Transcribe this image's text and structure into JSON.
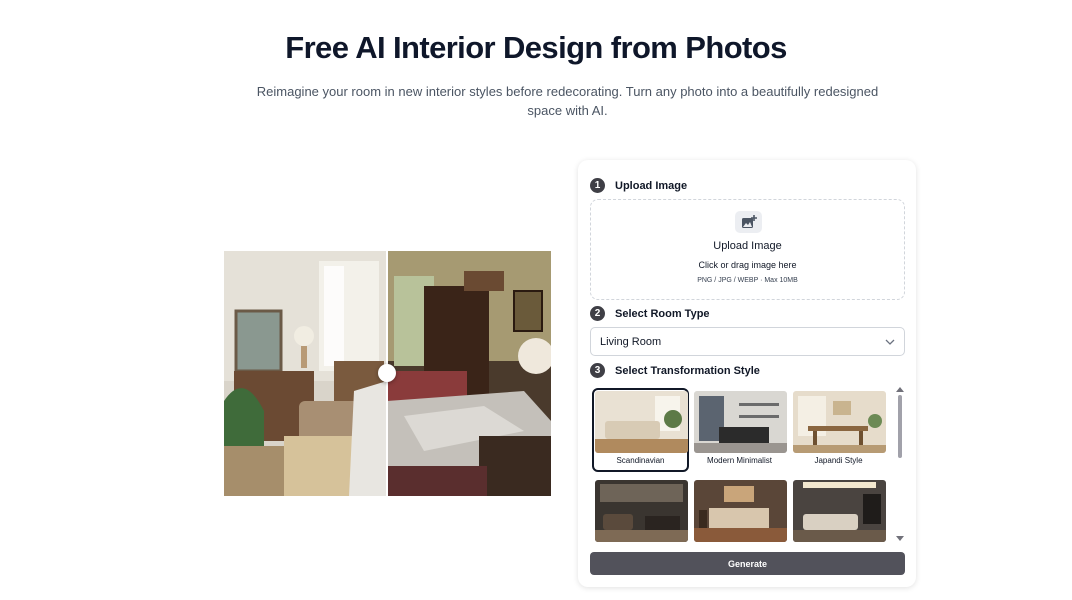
{
  "hero": {
    "title": "Free AI Interior Design from Photos",
    "subtitle": "Reimagine your room in new interior styles before redecorating. Turn any photo into a beautifully redesigned space with AI."
  },
  "steps": [
    {
      "number": "1",
      "label": "Upload Image"
    },
    {
      "number": "2",
      "label": "Select Room Type"
    },
    {
      "number": "3",
      "label": "Select Transformation Style"
    }
  ],
  "upload": {
    "icon": "image-plus-icon",
    "title": "Upload Image",
    "hint": "Click or drag image here",
    "formats": "PNG / JPG / WEBP · Max 10MB"
  },
  "room_type": {
    "selected": "Living Room",
    "icon": "chevron-down-icon"
  },
  "styles": [
    {
      "name": "Scandinavian",
      "selected": true
    },
    {
      "name": "Modern Minimalist",
      "selected": false
    },
    {
      "name": "Japandi Style",
      "selected": false
    },
    {
      "name": "",
      "selected": false
    },
    {
      "name": "",
      "selected": false
    },
    {
      "name": "",
      "selected": false
    }
  ],
  "generate_label": "Generate",
  "colors": {
    "step_badge": "#3f3f46",
    "generate_button": "#52525b",
    "title": "#0f172a"
  }
}
